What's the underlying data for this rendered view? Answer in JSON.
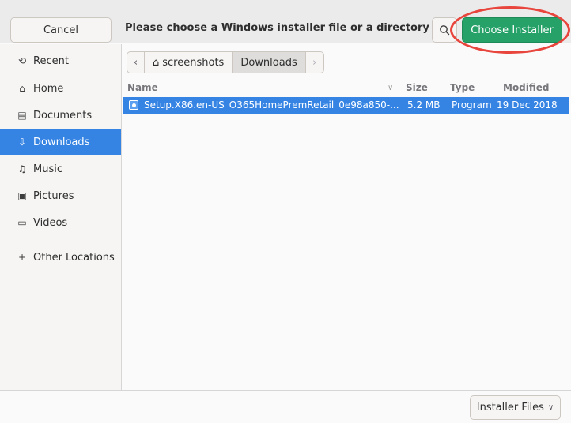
{
  "header": {
    "cancel_label": "Cancel",
    "title": "Please choose a Windows installer file or a directory th...",
    "choose_label": "Choose Installer",
    "accent_color": "#26a269",
    "highlight_color": "#e8453c"
  },
  "sidebar": {
    "items": [
      {
        "label": "Recent",
        "icon": "clock-icon",
        "glyph": "⟲"
      },
      {
        "label": "Home",
        "icon": "home-icon",
        "glyph": "⌂"
      },
      {
        "label": "Documents",
        "icon": "document-icon",
        "glyph": "▤"
      },
      {
        "label": "Downloads",
        "icon": "download-icon",
        "glyph": "⇩",
        "active": true
      },
      {
        "label": "Music",
        "icon": "music-icon",
        "glyph": "♫"
      },
      {
        "label": "Pictures",
        "icon": "picture-icon",
        "glyph": "▣"
      },
      {
        "label": "Videos",
        "icon": "video-icon",
        "glyph": "▭"
      },
      {
        "label": "Other Locations",
        "icon": "plus-icon",
        "glyph": "+"
      }
    ],
    "selection_color": "#3584e4"
  },
  "pathbar": {
    "segments": [
      "screenshots",
      "Downloads"
    ]
  },
  "list": {
    "columns": [
      "Name",
      "Size",
      "Type",
      "Modified"
    ],
    "rows": [
      {
        "name": "Setup.X86.en-US_O365HomePremRetail_0e98a850-...",
        "size": "5.2 MB",
        "type": "Program",
        "modified": "19 Dec 2018",
        "selected": true
      }
    ]
  },
  "footer": {
    "filter_label": "Installer Files"
  }
}
